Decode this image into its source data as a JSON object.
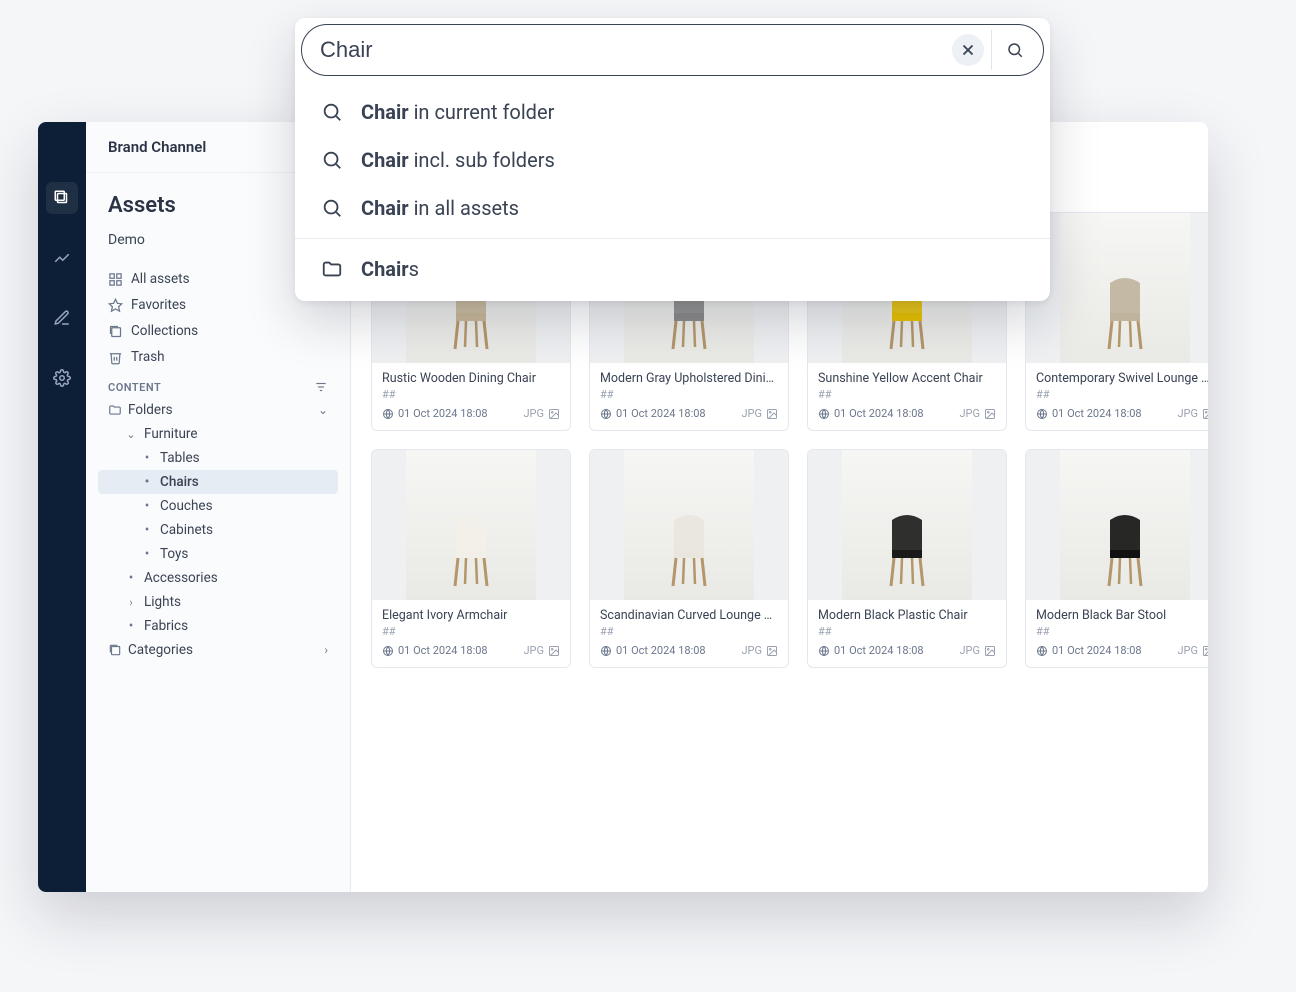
{
  "brand": "Brand Channel",
  "page_title": "Assets",
  "demo_label": "Demo",
  "nav": {
    "all_assets": "All assets",
    "favorites": "Favorites",
    "collections": "Collections",
    "trash": "Trash"
  },
  "section_content": "CONTENT",
  "tree": {
    "folders": "Folders",
    "furniture": "Furniture",
    "tables": "Tables",
    "chairs": "Chairs",
    "couches": "Couches",
    "cabinets": "Cabinets",
    "toys": "Toys",
    "accessories": "Accessories",
    "lights": "Lights",
    "fabrics": "Fabrics",
    "categories": "Categories"
  },
  "search": {
    "value": "Chair",
    "suggestions": [
      {
        "bold": "Chair",
        "rest": " in current folder"
      },
      {
        "bold": "Chair",
        "rest": " incl. sub folders"
      },
      {
        "bold": "Chair",
        "rest": " in all assets"
      }
    ],
    "folder_bold": "Chair",
    "folder_rest": "s"
  },
  "cards": [
    {
      "title": "Rustic Wooden Dining Chair",
      "hash": "##",
      "date": "01 Oct 2024 18:08",
      "ext": "JPG"
    },
    {
      "title": "Modern Gray Upholstered Dinin…",
      "hash": "##",
      "date": "01 Oct 2024 18:08",
      "ext": "JPG"
    },
    {
      "title": "Sunshine Yellow Accent Chair",
      "hash": "##",
      "date": "01 Oct 2024 18:08",
      "ext": "JPG"
    },
    {
      "title": "Contemporary Swivel Lounge C…",
      "hash": "##",
      "date": "01 Oct 2024 18:08",
      "ext": "JPG"
    },
    {
      "title": "Elegant Ivory Armchair",
      "hash": "##",
      "date": "01 Oct 2024 18:08",
      "ext": "JPG"
    },
    {
      "title": "Scandinavian Curved Lounge C…",
      "hash": "##",
      "date": "01 Oct 2024 18:08",
      "ext": "JPG"
    },
    {
      "title": "Modern Black Plastic Chair",
      "hash": "##",
      "date": "01 Oct 2024 18:08",
      "ext": "JPG"
    },
    {
      "title": "Modern Black Bar Stool",
      "hash": "##",
      "date": "01 Oct 2024 18:08",
      "ext": "JPG"
    }
  ]
}
